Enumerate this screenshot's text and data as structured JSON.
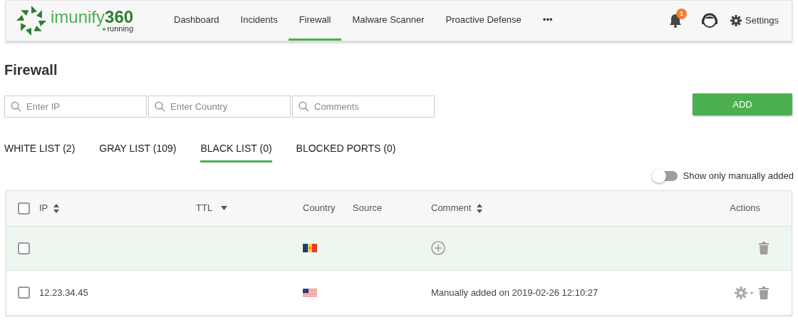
{
  "brand": {
    "name": "imunify",
    "number": "360",
    "status": "running"
  },
  "nav": [
    {
      "label": "Dashboard",
      "selected": false
    },
    {
      "label": "Incidents",
      "selected": false
    },
    {
      "label": "Firewall",
      "selected": true
    },
    {
      "label": "Malware Scanner",
      "selected": false
    },
    {
      "label": "Proactive Defense",
      "selected": false
    },
    {
      "label": "•••",
      "selected": false
    }
  ],
  "notifications": {
    "count": "1"
  },
  "settings": {
    "label": "Settings"
  },
  "page_title": "Firewall",
  "filters": [
    {
      "placeholder": "Enter IP"
    },
    {
      "placeholder": "Enter Country"
    },
    {
      "placeholder": "Comments"
    }
  ],
  "add_button": "ADD",
  "tabs": [
    {
      "label": "WHITE LIST (2)",
      "selected": false
    },
    {
      "label": "GRAY LIST (109)",
      "selected": false
    },
    {
      "label": "BLACK LIST (0)",
      "selected": true
    },
    {
      "label": "BLOCKED PORTS (0)",
      "selected": false
    }
  ],
  "toggle": {
    "label": "Show only manually added",
    "on": false
  },
  "table": {
    "select_all": {
      "checked": false
    },
    "columns": [
      {
        "label": "IP",
        "kind": "sortable"
      },
      {
        "label": "TTL",
        "kind": "dropdown"
      },
      {
        "label": "Country",
        "kind": "plain"
      },
      {
        "label": "Source",
        "kind": "plain"
      },
      {
        "label": "Comment",
        "kind": "sortable"
      },
      {
        "label": "Actions",
        "kind": "plain"
      }
    ],
    "rows": [
      {
        "kind": "new",
        "highlighted": true,
        "checked": false
      },
      {
        "kind": "entry",
        "ip": "12.23.34.45",
        "comment": "Manually added on 2019-02-26 12:10:27",
        "highlighted": false,
        "checked": false
      }
    ]
  }
}
